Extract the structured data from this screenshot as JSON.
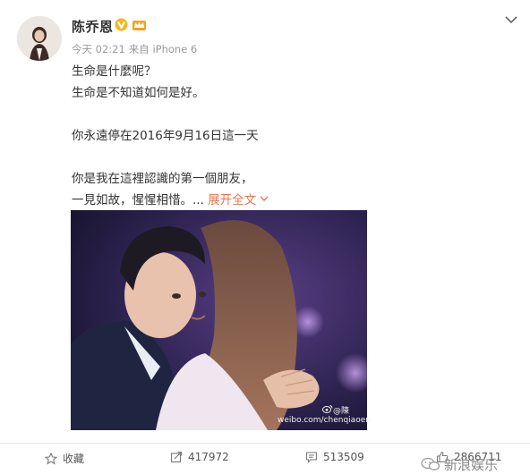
{
  "user": {
    "name": "陈乔恩",
    "badge_icon": "verified-v-icon",
    "member_icon": "member-crown-icon"
  },
  "meta": {
    "time": "今天 02:21",
    "source": "来自 iPhone 6"
  },
  "post": {
    "lines": [
      "生命是什麼呢？",
      "生命是不知道如何是好。",
      "",
      "你永遠停在2016年9月16日這一天",
      "",
      "你是我在這裡認識的第一個朋友，"
    ],
    "last_line": "一見如故，惺惺相惜。...",
    "expand_label": "展开全文"
  },
  "image": {
    "watermark_handle": "@陳",
    "watermark_url": "weibo.com/chenqiaoen"
  },
  "actions": {
    "favorite_label": "收藏",
    "share_count": "417972",
    "comment_count": "513509",
    "like_count": "2866711"
  },
  "wechat_watermark": "新浪娱乐",
  "colors": {
    "accent": "#eb7350",
    "verified": "#f6b61e",
    "text": "#333333",
    "meta": "#9a9a9a"
  }
}
